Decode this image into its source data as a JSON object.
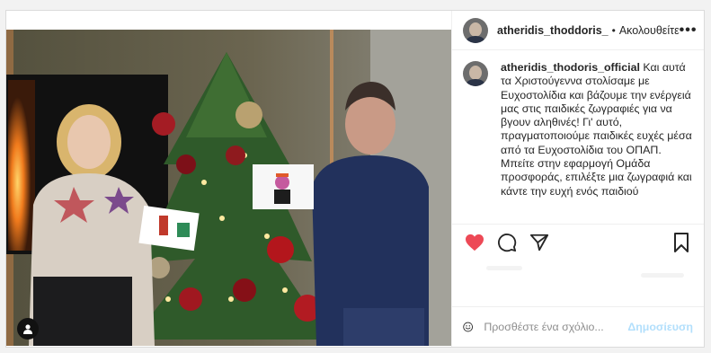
{
  "post": {
    "username": "atheridis_thoddoris_",
    "separator": "•",
    "follow_label": "Ακολουθείτε",
    "more_label": "•••",
    "caption_username": "atheridis_thodoris_official",
    "caption_text": "Και αυτά τα Χριστούγεννα στολίσαμε με Ευχοστολίδια και βάζουμε την ενέργειά μας στις παιδικές ζωγραφιές για να βγουν αληθινές! Γι' αυτό, πραγματοποιούμε παιδικές ευχές μέσα από τα Ευχοστολίδια του ΟΠΑΠ. Μπείτε στην εφαρμογή Ομάδα προσφοράς, επιλέξτε μια ζωγραφιά και κάντε την ευχή ενός παιδιού",
    "comment_placeholder": "Προσθέστε ένα σχόλιο...",
    "post_button": "Δημοσίευση"
  },
  "icons": {
    "like": "heart-icon",
    "comment": "comment-icon",
    "share": "share-icon",
    "save": "bookmark-icon",
    "emoji": "emoji-icon",
    "tag": "user-tag-icon"
  },
  "colors": {
    "like_active": "#ed4956",
    "post_button_disabled": "#b2dffc",
    "text": "#262626",
    "placeholder": "#8e8e8e"
  }
}
